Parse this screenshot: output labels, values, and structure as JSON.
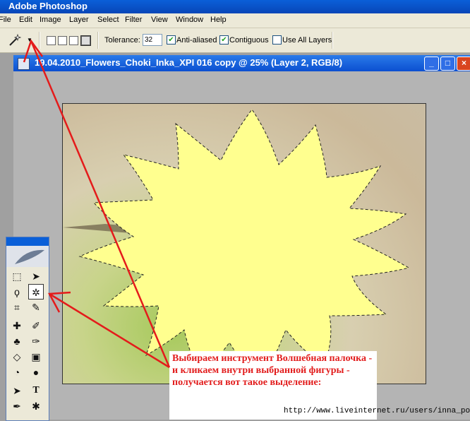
{
  "app": {
    "title": "Adobe Photoshop"
  },
  "menu": [
    "File",
    "Edit",
    "Image",
    "Layer",
    "Select",
    "Filter",
    "View",
    "Window",
    "Help"
  ],
  "options": {
    "tolerance_label": "Tolerance:",
    "tolerance_value": "32",
    "anti_aliased_label": "Anti-aliased",
    "anti_aliased_checked": true,
    "contiguous_label": "Contiguous",
    "contiguous_checked": true,
    "use_all_layers_label": "Use All Layers",
    "use_all_layers_checked": false
  },
  "document": {
    "title": "19.04.2010_Flowers_Choki_Inka_XPI 016 copy @ 25% (Layer 2, RGB/8)",
    "shape_fill": "#ffff8f"
  },
  "annotation": {
    "text": "Выбираем инструмент  Волшебная палочка  - и кликаем внутри выбранной фигуры - получается вот такое выделение:",
    "color": "#e21c1c"
  },
  "url": "http://www.liveinternet.ru/users/inna_pono/",
  "icons": {
    "magic_wand": "magic-wand-icon",
    "marquee": "marquee-icon",
    "move": "move-icon",
    "lasso": "lasso-icon",
    "crop": "crop-icon",
    "slice": "slice-icon",
    "healing": "healing-brush-icon",
    "brush": "brush-icon",
    "stamp": "clone-stamp-icon",
    "history_brush": "history-brush-icon",
    "eraser": "eraser-icon",
    "gradient": "gradient-icon",
    "blur": "blur-icon",
    "dodge": "dodge-icon",
    "path_select": "path-selection-icon",
    "type": "type-icon",
    "pen": "pen-icon",
    "shape": "custom-shape-icon"
  }
}
